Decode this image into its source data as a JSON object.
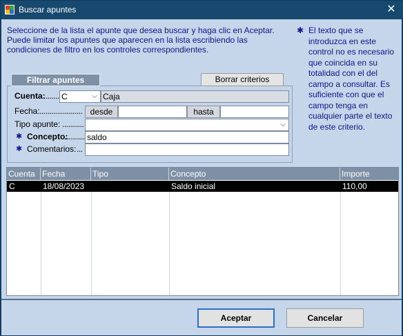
{
  "window": {
    "title": "Buscar apuntes",
    "close_glyph": "✕"
  },
  "intro": {
    "line1": "Seleccione de la lista el apunte que desea buscar y haga clic en Aceptar.",
    "line2": "Puede limitar los apuntes que aparecen en la lista escribiendo las condiciones de filtro en los controles correspondientes."
  },
  "note": {
    "star": "✱",
    "text": "El texto que se introduzca en este control no es necesario que coincida en su totalidad con el del campo a consultar. Es suficiente con que el campo tenga en cualquier parte el texto de este criterio."
  },
  "filter": {
    "tab_label": "Filtrar apuntes",
    "clear_button": "Borrar criterios",
    "cuenta_label": "Cuenta:",
    "cuenta_dots": "........",
    "cuenta_value": "C",
    "cuenta_name": "Caja",
    "fecha_label": "Fecha:",
    "fecha_dots": "......................",
    "desde_label": "desde",
    "desde_value": "",
    "hasta_label": "hasta",
    "hasta_value": "",
    "tipo_label": "Tipo apunte:",
    "tipo_dots": "...........",
    "tipo_value": "",
    "concepto_label": "Concepto:",
    "concepto_dots": "............",
    "concepto_value": "saldo",
    "comentarios_label": "Comentarios:",
    "comentarios_dots": "...",
    "comentarios_value": "",
    "star": "✱"
  },
  "table": {
    "columns": [
      "Cuenta",
      "Fecha",
      "Tipo",
      "Concepto",
      "Importe"
    ],
    "rows": [
      {
        "cuenta": "C",
        "fecha": "18/08/2023",
        "tipo": "",
        "concepto": "Saldo inicial",
        "importe": "110,00"
      }
    ]
  },
  "footer": {
    "accept": "Aceptar",
    "cancel": "Cancelar"
  },
  "colors": {
    "titlebar": "#17496f",
    "panel": "#c5d5ea",
    "accent_text": "#14148c",
    "header": "#7e90a6",
    "selected_row": "#000000"
  }
}
